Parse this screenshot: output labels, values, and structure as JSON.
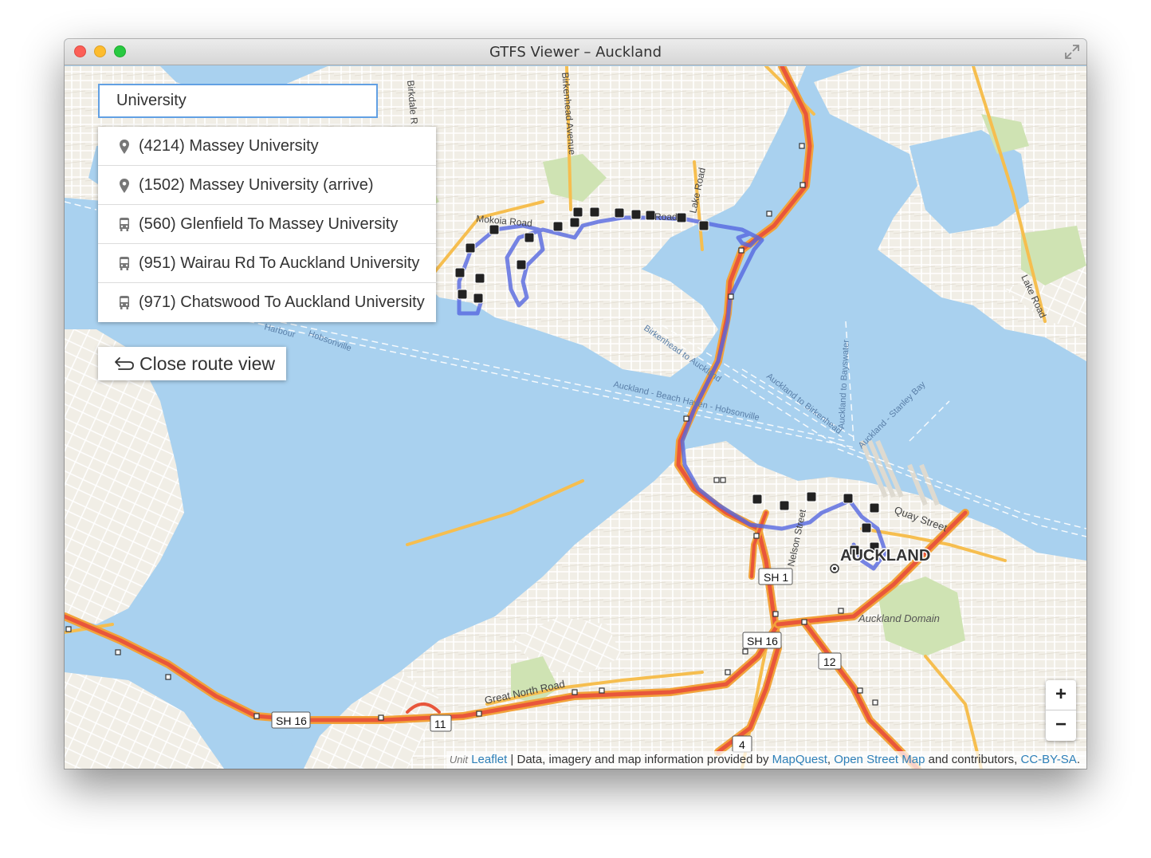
{
  "window": {
    "title": "GTFS Viewer – Auckland"
  },
  "search": {
    "value": "University"
  },
  "results": [
    {
      "type": "stop",
      "label": "(4214) Massey University",
      "icon": "map-pin-icon"
    },
    {
      "type": "stop",
      "label": "(1502) Massey University (arrive)",
      "icon": "map-pin-icon"
    },
    {
      "type": "route",
      "label": "(560) Glenfield To Massey University",
      "icon": "bus-icon"
    },
    {
      "type": "route",
      "label": "(951) Wairau Rd To Auckland University",
      "icon": "bus-icon"
    },
    {
      "type": "route",
      "label": "(971) Chatswood To Auckland University",
      "icon": "bus-icon"
    }
  ],
  "close_route": {
    "label": "Close route view",
    "icon": "return-arrow-icon"
  },
  "zoom": {
    "in_label": "+",
    "out_label": "−"
  },
  "attribution": {
    "faded": "Unit",
    "leaflet": "Leaflet",
    "sep": " | Data, imagery and map information provided by ",
    "mapquest": "MapQuest",
    "comma": ", ",
    "osm": "Open Street Map",
    "and": " and contributors, ",
    "license": "CC-BY-SA",
    "end": "."
  },
  "map_labels": {
    "auckland": "AUCKLAND",
    "auckland_domain": "Auckland Domain",
    "quay_street": "Quay Street",
    "nelson_street": "Nelson Street",
    "great_north_road": "Great North Road",
    "mokoia_road": "Mokoia Road",
    "road_partial": "Road",
    "lake_road": "Lake Road",
    "lake_road_east": "Lake Road",
    "birkenhead_avenue": "Birkenhead Avenue",
    "birkdale_road": "Birkdale R",
    "birkenhead_ferry": "Birkenhead to Auckland",
    "beach_haven_ferry": "Auckland - Beach Haven - Hobsonville",
    "auckland_birkenhead": "Auckland to Birkenhead",
    "auckland_bayswater": "Auckland to Bayswater",
    "auckland_stanley": "Auckland - Stanley Bay",
    "harbour": "Harbour",
    "hobsonville": "Hobsonville",
    "sh1": "SH 1",
    "sh16_center": "SH 16",
    "sh16_west": "SH 16",
    "r11": "11",
    "r12": "12",
    "r4": "4"
  },
  "colors": {
    "water": "#a9d1ef",
    "land": "#f1eee6",
    "park": "#cfe3b3",
    "motorway": "#e8563b",
    "motorway_casing": "#f2a23a",
    "route": "#5567e0",
    "accent": "#62a0e3"
  }
}
